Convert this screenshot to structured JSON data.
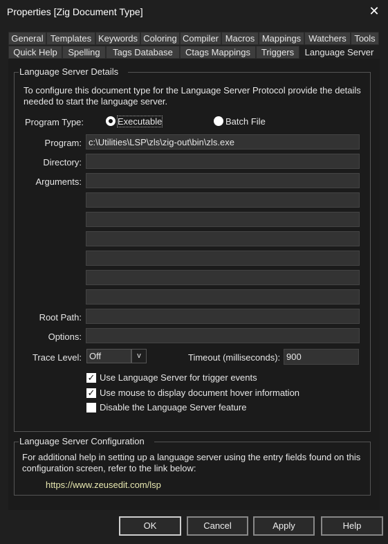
{
  "window": {
    "title": "Properties [Zig Document Type]"
  },
  "tabs_row1": [
    "General",
    "Templates",
    "Keywords",
    "Coloring",
    "Compiler",
    "Macros",
    "Mappings",
    "Watchers",
    "Tools"
  ],
  "tabs_row2": [
    "Quick Help",
    "Spelling",
    "Tags Database",
    "Ctags Mappings",
    "Triggers",
    "Language Server"
  ],
  "active_tab": "Language Server",
  "details": {
    "legend": "Language Server Details",
    "intro": "To configure this document type for the Language Server Protocol provide the details needed to start the language server.",
    "program_type_label": "Program Type:",
    "radio_executable": "Executable",
    "radio_batch": "Batch File",
    "selected_program_type": "Executable",
    "program_label": "Program:",
    "program_value": "c:\\Utilities\\LSP\\zls\\zig-out\\bin\\zls.exe",
    "directory_label": "Directory:",
    "directory_value": "",
    "arguments_label": "Arguments:",
    "arguments": [
      "",
      "",
      "",
      "",
      "",
      "",
      ""
    ],
    "root_path_label": "Root Path:",
    "root_path_value": "",
    "options_label": "Options:",
    "options_value": "",
    "trace_label": "Trace Level:",
    "trace_value": "Off",
    "trace_button": "v",
    "timeout_label": "Timeout (milliseconds):",
    "timeout_value": "900",
    "checkboxes": [
      {
        "label": "Use Language Server for trigger events",
        "checked": true
      },
      {
        "label": "Use mouse to display document hover information",
        "checked": true
      },
      {
        "label": "Disable the Language Server feature",
        "checked": false
      }
    ]
  },
  "config": {
    "legend": "Language Server Configuration",
    "text": "For additional help in setting up a language server using the entry fields found on this configuration screen, refer to the link below:",
    "link": "https://www.zeusedit.com/lsp"
  },
  "buttons": {
    "ok": "OK",
    "cancel": "Cancel",
    "apply": "Apply",
    "help": "Help"
  },
  "colors": {
    "background": "#1f1f1f",
    "tab": "#3d3d3d",
    "input": "#333333",
    "link": "#e8e8b0"
  }
}
